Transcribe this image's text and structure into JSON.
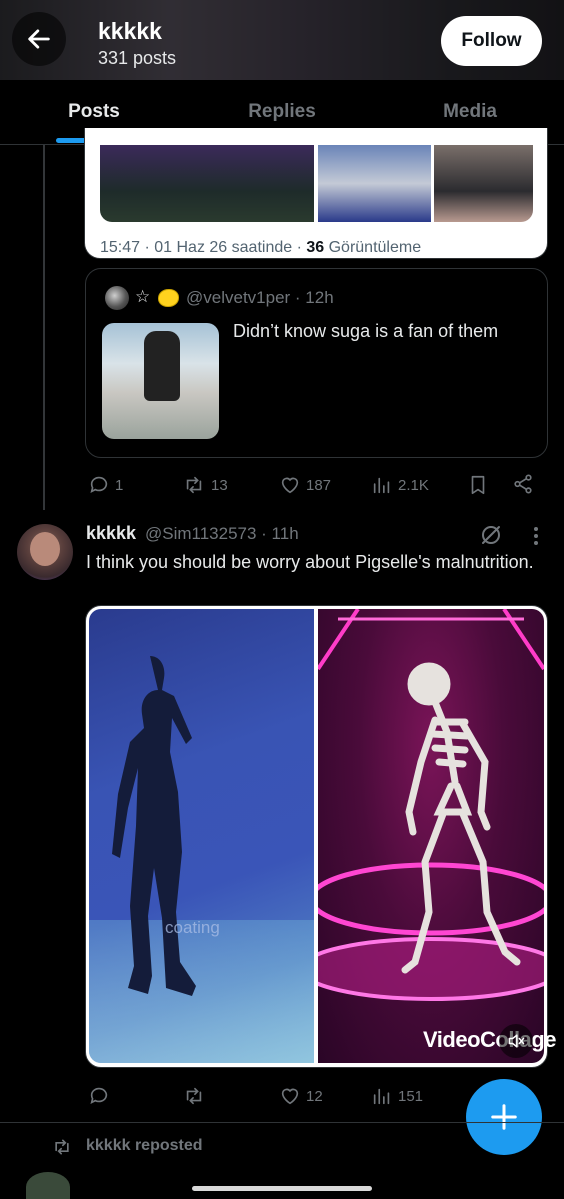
{
  "header": {
    "name": "kkkkk",
    "posts_count": "331 posts",
    "follow_label": "Follow"
  },
  "tabs": [
    {
      "label": "Posts",
      "active": true
    },
    {
      "label": "Replies",
      "active": false
    },
    {
      "label": "Media",
      "active": false
    }
  ],
  "quoted_post_1": {
    "time_prefix": "15:47 · 01 Haz 26 saatinde · ",
    "views_count": "36",
    "views_label": " Görüntüleme"
  },
  "quoted_post_2": {
    "emoji": "☆",
    "handle": "@velvetv1per · 12h",
    "text": "Didn’t know suga is a fan of them"
  },
  "actions_1": {
    "replies": "1",
    "reposts": "13",
    "likes": "187",
    "views": "2.1K"
  },
  "post": {
    "author": "kkkkk",
    "handle": "@Sim1132573 · 11h",
    "text": "I think you should be worry about Pigselle's malnutrition.",
    "watermark_left": "coating",
    "watermark_right": "VideoCollage"
  },
  "actions_2": {
    "replies": "",
    "reposts": "",
    "likes": "12",
    "views": "151"
  },
  "repost_banner": {
    "label": "kkkkk reposted"
  },
  "colors": {
    "accent": "#1d9bf0",
    "background": "#000000",
    "muted_text": "#71767b",
    "divider": "#2f3336"
  },
  "icons": [
    "back-arrow-icon",
    "reply-icon",
    "repost-icon",
    "like-icon",
    "views-icon",
    "bookmark-icon",
    "share-icon",
    "grok-icon",
    "more-icon",
    "volume-icon",
    "compose-plus-icon"
  ]
}
